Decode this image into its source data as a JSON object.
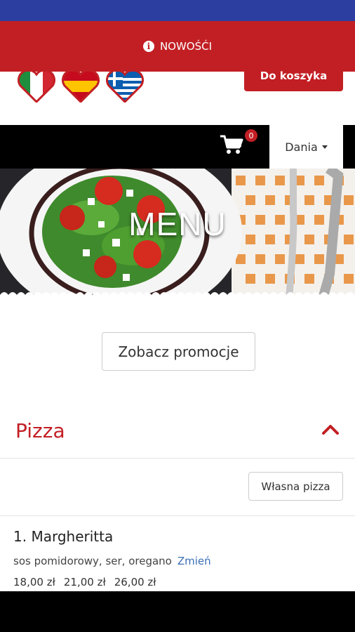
{
  "news_bar": {
    "label": "NOWOŚĆI",
    "icon": "info-icon"
  },
  "flags": [
    {
      "name": "italy-flag-icon"
    },
    {
      "name": "spain-flag-icon"
    },
    {
      "name": "greece-flag-icon"
    }
  ],
  "cart": {
    "count": "0",
    "icon": "cart-icon"
  },
  "dish_dropdown": {
    "label": "Dania"
  },
  "hero": {
    "title": "MENU"
  },
  "promo_button": {
    "label": "Zobacz promocje"
  },
  "category": {
    "title": "Pizza"
  },
  "own_pizza_button": {
    "label": "Własna pizza"
  },
  "item": {
    "name": "1. Margheritta",
    "description": "sos pomidorowy, ser, oregano",
    "change_link": "Zmień",
    "prices": [
      "18,00 zł",
      "21,00 zł",
      "26,00 zł"
    ],
    "add_button": "Do koszyka"
  },
  "colors": {
    "accent": "#c21f24",
    "status_bar": "#2c3fa0",
    "link": "#3a6fb5"
  }
}
